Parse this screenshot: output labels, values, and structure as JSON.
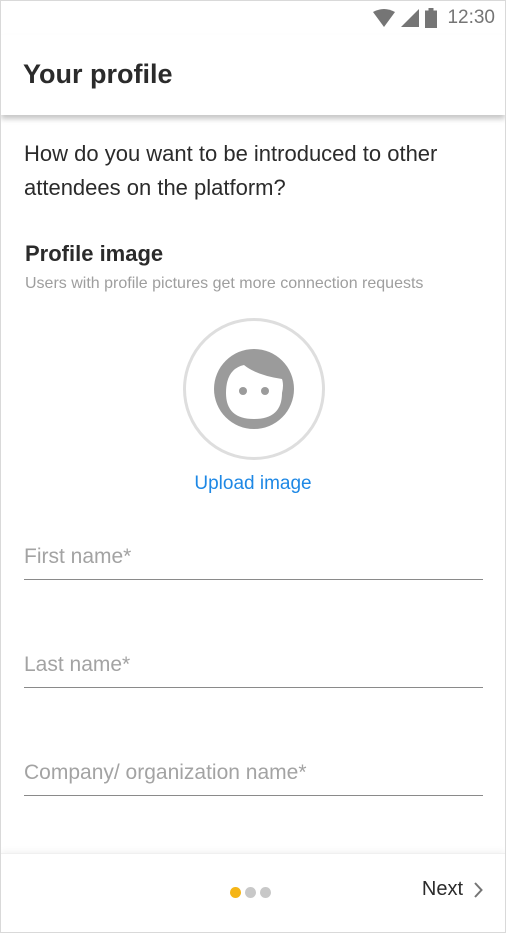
{
  "status_bar": {
    "time": "12:30",
    "icons": [
      "wifi-icon",
      "signal-icon",
      "battery-icon"
    ]
  },
  "header": {
    "title": "Your profile"
  },
  "main": {
    "intro": "How do you want to be introduced to other attendees on the platform?",
    "profile_image": {
      "title": "Profile image",
      "subtitle": "Users with profile pictures get more connection requests",
      "avatar_icon": "avatar-face-icon",
      "upload_label": "Upload image"
    },
    "fields": {
      "first_name": {
        "placeholder": "First name*",
        "value": ""
      },
      "last_name": {
        "placeholder": "Last name*",
        "value": ""
      },
      "company": {
        "placeholder": "Company/ organization name*",
        "value": ""
      }
    }
  },
  "footer": {
    "pagination": {
      "current": 1,
      "total": 3
    },
    "next_label": "Next",
    "next_icon": "chevron-right-icon"
  },
  "colors": {
    "accent_link": "#1e88e5",
    "active_dot": "#f5b516",
    "inactive_dot": "#c8c8c8"
  }
}
